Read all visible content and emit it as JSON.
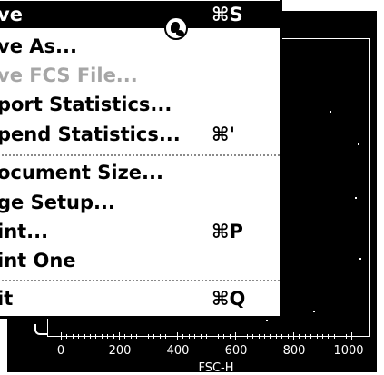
{
  "menu": {
    "items": [
      {
        "label": "ve",
        "shortcut": "⌘S",
        "state": "highlighted"
      },
      {
        "label": "ve As...",
        "shortcut": "",
        "state": "enabled"
      },
      {
        "label": "ve FCS File...",
        "shortcut": "",
        "state": "disabled"
      },
      {
        "label": "port Statistics...",
        "shortcut": "",
        "state": "enabled"
      },
      {
        "label": "pend Statistics...",
        "shortcut": "⌘'",
        "state": "enabled"
      },
      {
        "label": "ocument Size...",
        "shortcut": "",
        "state": "enabled"
      },
      {
        "label": "ge Setup...",
        "shortcut": "",
        "state": "enabled"
      },
      {
        "label": "int...",
        "shortcut": "⌘P",
        "state": "enabled"
      },
      {
        "label": "int One",
        "shortcut": "",
        "state": "enabled"
      },
      {
        "label": "it",
        "shortcut": "⌘Q",
        "state": "enabled"
      }
    ]
  },
  "cursor": {
    "icon": "wait-cursor-icon"
  },
  "plot": {
    "x_axis_title": "FSC-H",
    "x_tick_labels": [
      "0",
      "200",
      "400",
      "600",
      "800",
      "1000"
    ]
  },
  "colors": {
    "plot_background": "#000000",
    "menu_background": "#ffffff",
    "highlight": "#000000",
    "disabled_text": "#a6a6a6"
  }
}
